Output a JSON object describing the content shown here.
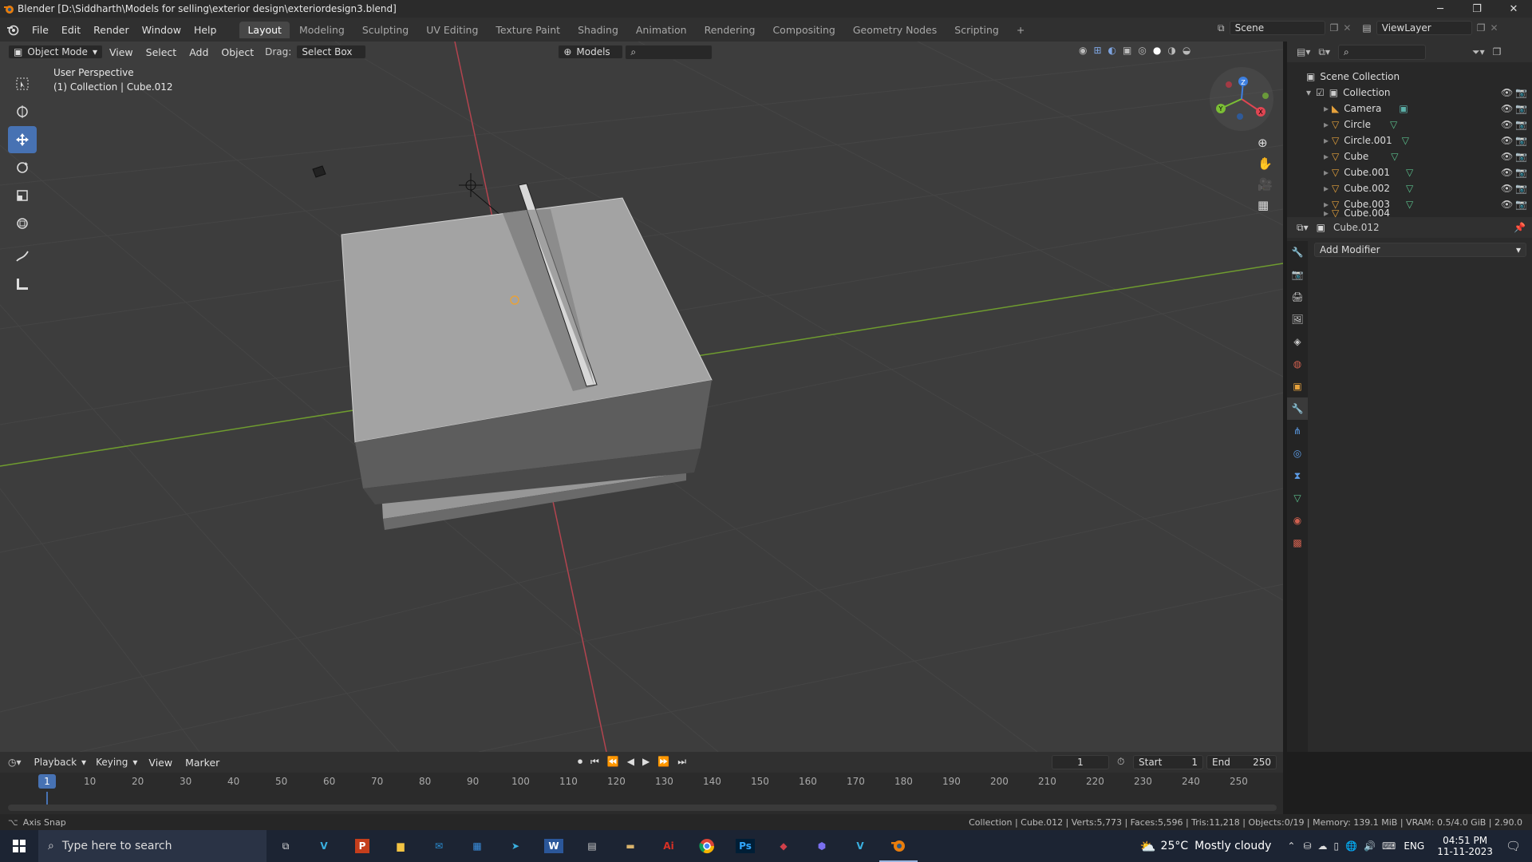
{
  "window": {
    "title": "Blender [D:\\Siddharth\\Models for selling\\exterior design\\exteriordesign3.blend]",
    "minimize": "─",
    "restore": "❐",
    "close": "✕"
  },
  "menubar": {
    "menus": [
      "File",
      "Edit",
      "Render",
      "Window",
      "Help"
    ],
    "workspaces": [
      "Layout",
      "Modeling",
      "Sculpting",
      "UV Editing",
      "Texture Paint",
      "Shading",
      "Animation",
      "Rendering",
      "Compositing",
      "Geometry Nodes",
      "Scripting"
    ],
    "add_workspace": "+",
    "scene": "Scene",
    "view_layer": "ViewLayer"
  },
  "viewport_header": {
    "mode": "Object Mode",
    "view": "View",
    "select": "Select",
    "add": "Add",
    "object": "Object",
    "drag_label": "Drag:",
    "drag_value": "Select Box",
    "orientation": "Models",
    "search_placeholder": ""
  },
  "viewport": {
    "perspective": "User Perspective",
    "collection_info": "(1) Collection | Cube.012",
    "colors": {
      "bg": "#3d3d3d",
      "grid": "#474747",
      "x_axis": "#b3444f",
      "y_axis": "#6f9c2f",
      "mesh_light": "#ababab",
      "mesh_dark": "#5a5a5a"
    },
    "gizmo": {
      "x": "X",
      "y": "Y",
      "z": "Z"
    }
  },
  "outliner": {
    "root": "Scene Collection",
    "collection": "Collection",
    "items": [
      {
        "name": "Camera",
        "type": "camera"
      },
      {
        "name": "Circle",
        "type": "mesh"
      },
      {
        "name": "Circle.001",
        "type": "mesh"
      },
      {
        "name": "Cube",
        "type": "mesh"
      },
      {
        "name": "Cube.001",
        "type": "mesh"
      },
      {
        "name": "Cube.002",
        "type": "mesh"
      },
      {
        "name": "Cube.003",
        "type": "mesh"
      },
      {
        "name": "Cube.004",
        "type": "mesh"
      }
    ]
  },
  "properties": {
    "object_name": "Cube.012",
    "add_modifier": "Add Modifier"
  },
  "timeline": {
    "playback": "Playback",
    "keying": "Keying",
    "view": "View",
    "marker": "Marker",
    "current_frame": "1",
    "start_label": "Start",
    "start": "1",
    "end_label": "End",
    "end": "250",
    "ruler": [
      "10",
      "20",
      "30",
      "40",
      "50",
      "60",
      "70",
      "80",
      "90",
      "100",
      "110",
      "120",
      "130",
      "140",
      "150",
      "160",
      "170",
      "180",
      "190",
      "200",
      "210",
      "220",
      "230",
      "240",
      "250"
    ],
    "cursor_label": "1"
  },
  "statusbar": {
    "left": "Axis Snap",
    "right": "Collection | Cube.012 | Verts:5,773 | Faces:5,596 | Tris:11,218 | Objects:0/19 | Memory: 139.1 MiB | VRAM: 0.5/4.0 GiB | 2.90.0"
  },
  "taskbar": {
    "search_placeholder": "Type here to search",
    "weather_temp": "25°C",
    "weather_desc": "Mostly cloudy",
    "lang": "ENG",
    "time": "04:51 PM",
    "date": "11-11-2023"
  }
}
